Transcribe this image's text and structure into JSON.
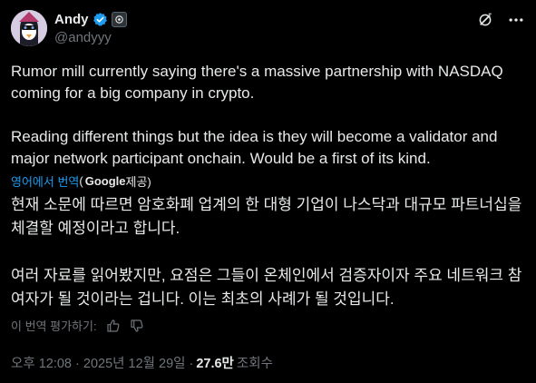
{
  "author": {
    "name": "Andy",
    "handle": "@andyyy"
  },
  "tweet": {
    "paragraph1": "Rumor mill currently saying there's a massive partnership with NASDAQ coming for a big company in crypto.",
    "paragraph2": "Reading different things but the idea is they will become a validator and major network participant onchain. Would be a first of its kind."
  },
  "translation": {
    "label": "영어에서 번역",
    "paren_open": "( ",
    "provider": "Google",
    "paren_close": " 제공)",
    "paragraph1": "현재 소문에 따르면 암호화폐 업계의 한 대형 기업이 나스닥과 대규모 파트너십을 체결할 예정이라고 합니다.",
    "paragraph2": "여러 자료를 읽어봤지만, 요점은 그들이 온체인에서 검증자이자 주요 네트워크 참여자가 될 것이라는 겁니다. 이는 최초의 사례가 될 것입니다.",
    "rate_label": "이 번역 평가하기:"
  },
  "meta": {
    "time": "오후 12:08 · 2025년 12월 29일 · ",
    "views": "27.6만",
    "views_label": "조회수"
  },
  "colors": {
    "background": "#000000",
    "text": "#e7e9ea",
    "muted": "#71767b",
    "accent": "#1d9bf0"
  },
  "icons": {
    "verified": "verified-badge-icon",
    "affiliate": "affiliate-badge-icon",
    "grok": "grok-icon",
    "more": "more-icon",
    "thumbs_up": "thumbs-up-icon",
    "thumbs_down": "thumbs-down-icon"
  }
}
